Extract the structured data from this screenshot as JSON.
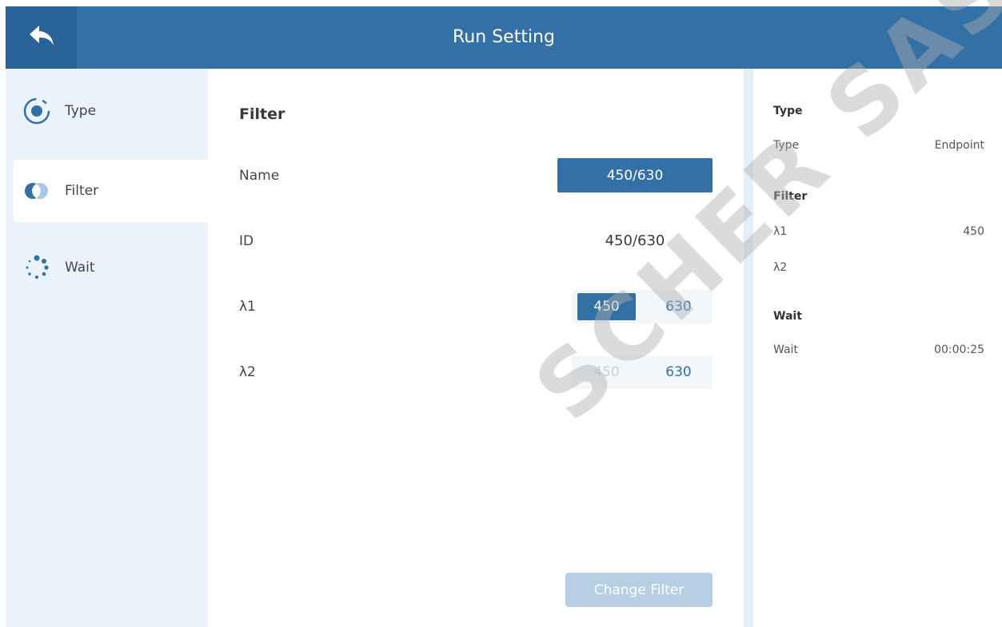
{
  "header": {
    "title": "Run Setting",
    "back_icon": "back-arrow-icon"
  },
  "sidebar": {
    "items": [
      {
        "label": "Type",
        "icon": "type-radio-icon",
        "active": false
      },
      {
        "label": "Filter",
        "icon": "filter-circles-icon",
        "active": true
      },
      {
        "label": "Wait",
        "icon": "wait-dots-icon",
        "active": false
      }
    ]
  },
  "filter": {
    "title": "Filter",
    "name_label": "Name",
    "name_value": "450/630",
    "id_label": "ID",
    "id_value": "450/630",
    "lambda1_label": "λ1",
    "lambda1_options": [
      "450",
      "630"
    ],
    "lambda1_selected": "450",
    "lambda2_label": "λ2",
    "lambda2_options": [
      "450",
      "630"
    ],
    "lambda2_disabled": "450",
    "change_button": "Change Filter"
  },
  "summary": {
    "type_heading": "Type",
    "type_key": "Type",
    "type_value": "Endpoint",
    "filter_heading": "Filter",
    "lambda1_key": "λ1",
    "lambda1_value": "450",
    "lambda2_key": "λ2",
    "wait_heading": "Wait",
    "wait_key": "Wait",
    "wait_value": "00:00:25"
  },
  "watermark": "SCHER SAS",
  "colors": {
    "primary": "#3270a6",
    "sidebar_bg": "#eaf2fc",
    "disabled_button": "#b7cfe4"
  }
}
